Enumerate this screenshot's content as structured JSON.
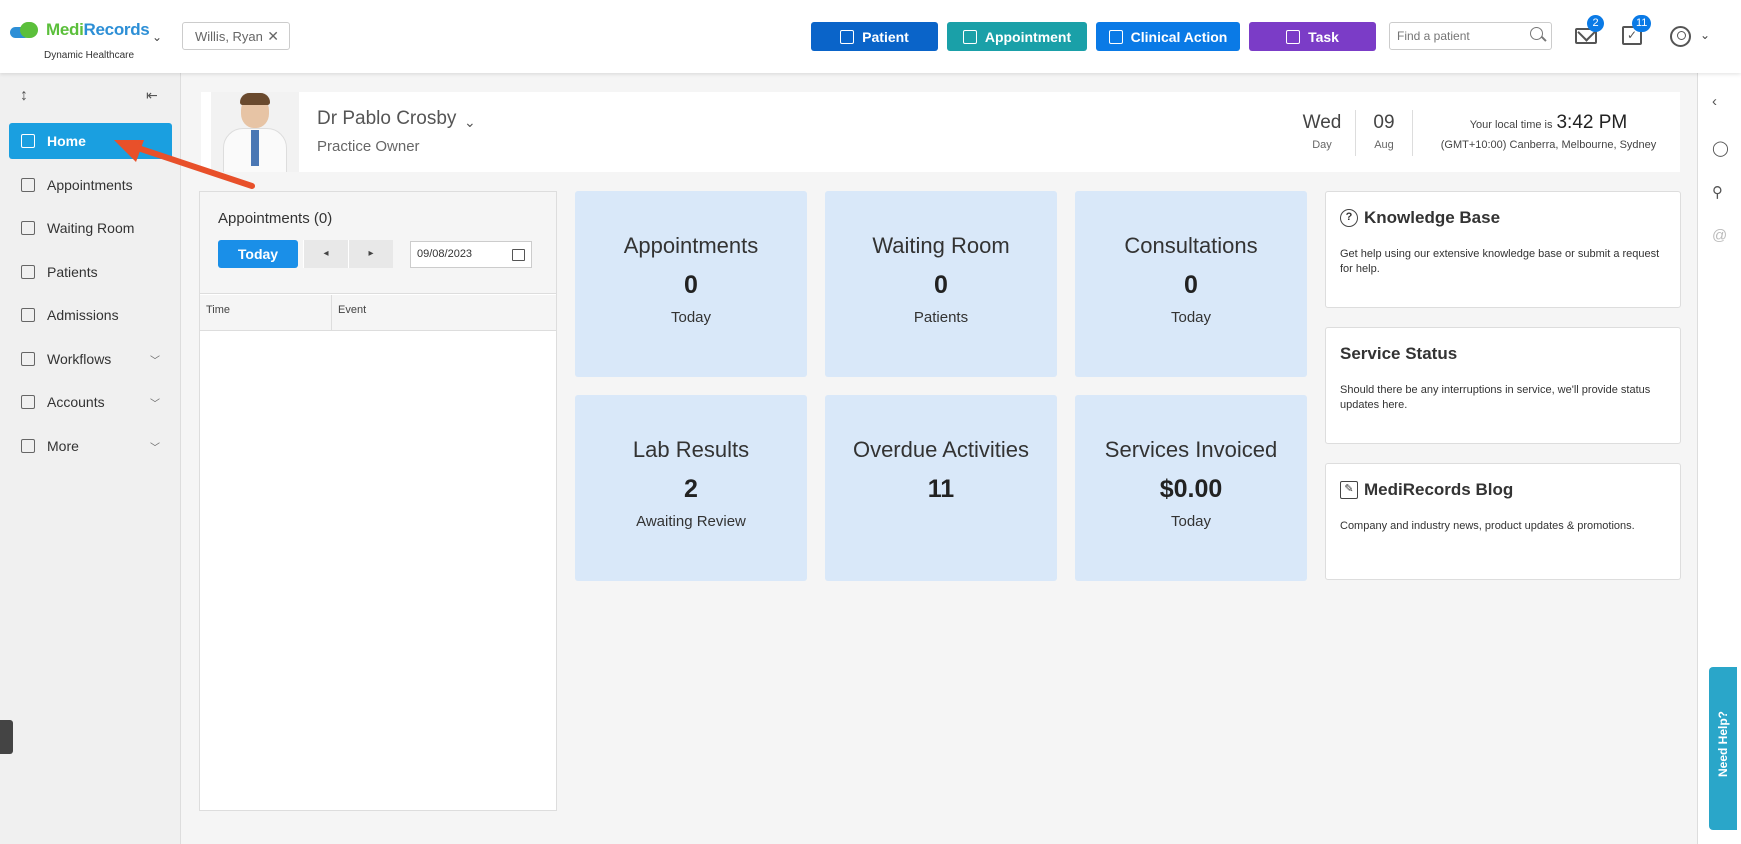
{
  "header": {
    "logo_medi": "Medi",
    "logo_records": "Records",
    "logo_sub": "Dynamic Healthcare",
    "patient_chip": "Willis, Ryan",
    "buttons": {
      "patient": "Patient",
      "appointment": "Appointment",
      "clinical_action": "Clinical Action",
      "task": "Task"
    },
    "find_placeholder": "Find a patient",
    "mail_count": "2",
    "task_count": "11"
  },
  "sidebar": {
    "items": [
      {
        "label": "Home",
        "icon": "home-icon",
        "active": true
      },
      {
        "label": "Appointments",
        "icon": "calendar-icon"
      },
      {
        "label": "Waiting Room",
        "icon": "people-icon"
      },
      {
        "label": "Patients",
        "icon": "patients-icon"
      },
      {
        "label": "Admissions",
        "icon": "building-icon"
      },
      {
        "label": "Workflows",
        "icon": "workflow-icon",
        "expandable": true
      },
      {
        "label": "Accounts",
        "icon": "folder-icon",
        "expandable": true
      },
      {
        "label": "More",
        "icon": "more-folder-icon",
        "expandable": true
      }
    ]
  },
  "profile": {
    "name": "Dr Pablo Crosby",
    "role": "Practice Owner",
    "day": "Wed",
    "day_label": "Day",
    "date": "09",
    "month": "Aug",
    "local_time_label": "Your local time is",
    "local_time": "3:42 PM",
    "timezone": "(GMT+10:00) Canberra, Melbourne, Sydney"
  },
  "appointments_panel": {
    "title": "Appointments (0)",
    "today_label": "Today",
    "prev": "◂",
    "next": "▸",
    "date_value": "09/08/2023",
    "col_time": "Time",
    "col_event": "Event"
  },
  "tiles": [
    {
      "title": "Appointments",
      "value": "0",
      "sub": "Today"
    },
    {
      "title": "Waiting Room",
      "value": "0",
      "sub": "Patients"
    },
    {
      "title": "Consultations",
      "value": "0",
      "sub": "Today"
    },
    {
      "title": "Lab Results",
      "value": "2",
      "sub": "Awaiting Review"
    },
    {
      "title": "Overdue Activities",
      "value": "11",
      "sub": ""
    },
    {
      "title": "Services Invoiced",
      "value": "$0.00",
      "sub": "Today"
    }
  ],
  "cards": [
    {
      "title": "Knowledge Base",
      "icon": "question-icon",
      "text": "Get help using our extensive knowledge base or submit a request for help."
    },
    {
      "title": "Service Status",
      "icon": "",
      "text": "Should there be any interruptions in service, we'll provide status updates here."
    },
    {
      "title": "MediRecords Blog",
      "icon": "edit-icon",
      "text": "Company and industry news, product updates & promotions."
    }
  ],
  "help_tab": "Need Help?",
  "colors": {
    "patient_btn": "#0a64c9",
    "appointment_btn": "#1aa0a8",
    "clinical_btn": "#0a7ae6",
    "task_btn": "#7b3cc7",
    "active_nav": "#1a9fe0",
    "tile_bg": "#d9e8f9",
    "arrow": "#e8502a"
  }
}
